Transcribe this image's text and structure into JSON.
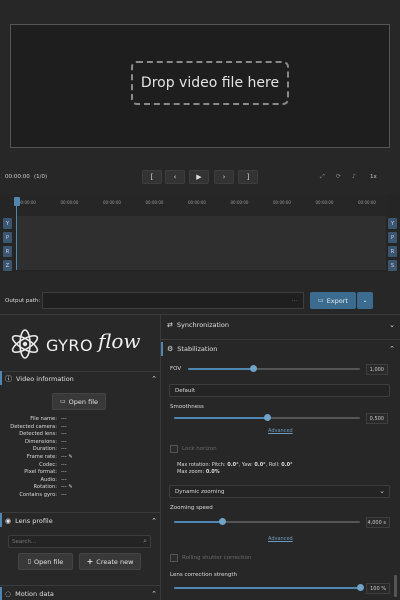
{
  "drop": {
    "label": "Drop video file here"
  },
  "playback": {
    "time": "00:00:00",
    "frame": "(1/0)",
    "btn_in": "[",
    "btn_prev": "‹",
    "btn_play": "▶",
    "btn_next": "›",
    "btn_out": "]",
    "speed": "1x"
  },
  "timeline": {
    "ticks": [
      "00:00:00",
      "00:00:00",
      "00:00:00",
      "00:00:00",
      "00:00:00",
      "00:00:00",
      "00:00:00",
      "00:00:00",
      "00:00:00"
    ],
    "left_axes": [
      "Y",
      "P",
      "R",
      "Z"
    ],
    "right_axes": [
      "Y",
      "P",
      "R",
      "S"
    ]
  },
  "output": {
    "label": "Output path:",
    "ellipsis": "...",
    "export": "Export",
    "dropdown": "⌄"
  },
  "logo": {
    "text_gyro": "GYRO",
    "text_flow": "flow"
  },
  "video_info": {
    "title": "Video information",
    "open_file": "Open file",
    "rows": [
      {
        "k": "File name:",
        "v": "---"
      },
      {
        "k": "Detected camera:",
        "v": "---"
      },
      {
        "k": "Detected lens:",
        "v": "---"
      },
      {
        "k": "Dimensions:",
        "v": "---"
      },
      {
        "k": "Duration:",
        "v": "---"
      },
      {
        "k": "Frame rate:",
        "v": "--- ✎"
      },
      {
        "k": "Codec:",
        "v": "---"
      },
      {
        "k": "Pixel format:",
        "v": "---"
      },
      {
        "k": "Audio:",
        "v": "---"
      },
      {
        "k": "Rotation:",
        "v": "--- ✎"
      },
      {
        "k": "Contains gyro:",
        "v": "---"
      }
    ]
  },
  "lens_profile": {
    "title": "Lens profile",
    "search_placeholder": "Search...",
    "open_file": "Open file",
    "create_new": "Create new"
  },
  "motion_data": {
    "title": "Motion data"
  },
  "sync": {
    "title": "Synchronization"
  },
  "stabilization": {
    "title": "Stabilization",
    "fov_label": "FOV",
    "fov_value": "1,000",
    "fov_fraction": 0.38,
    "method": "Default",
    "smoothness_label": "Smoothness",
    "smoothness_value": "0,500",
    "smoothness_fraction": 0.5,
    "advanced": "Advanced",
    "lock_horizon": "Lock horizon",
    "max_rotation_prefix": "Max rotation: Pitch: ",
    "pitch": "0.0°",
    "yaw_prefix": ", Yaw: ",
    "yaw": "0.0°",
    "roll_prefix": ", Roll: ",
    "roll": "0.0°",
    "max_zoom_prefix": "Max zoom: ",
    "max_zoom": "0.0%",
    "zooming_mode": "Dynamic zooming",
    "zooming_speed_label": "Zooming speed",
    "zooming_speed_value": "4,000 s",
    "zooming_speed_fraction": 0.26,
    "advanced2": "Advanced",
    "rolling_shutter": "Rolling shutter correction",
    "lens_correction_label": "Lens correction strength",
    "lens_correction_value": "100 %",
    "lens_correction_fraction": 1.0
  },
  "colors": {
    "accent": "#4f87b0",
    "button_blue": "#3b6c90",
    "bg": "#272727"
  }
}
